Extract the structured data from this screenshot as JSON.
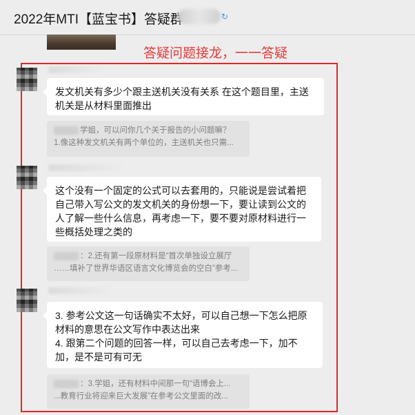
{
  "header": {
    "title": "2022年MTI【蓝宝书】答疑群",
    "sticker_glyph": "↻"
  },
  "callout": "答疑问题接龙，一一答疑",
  "messages": [
    {
      "text": "发文机关有多少个跟主送机关没有关系 在这个题目里，主送机关是从材料里面推出",
      "quote_lines": [
        "学姐，可以问你几个关于报告的小问题嘛？",
        "1.像这种发文机关有两个单位的，主送机关也只需..."
      ]
    },
    {
      "text": "这个没有一个固定的公式可以去套用的，只能说是尝试着把自己带入写公文的发文机关的身份想一下，要让读到公文的人了解一些什么信息，再考虑一下，要不要对原材料进行一些概括处理之类的",
      "quote_lines": [
        "：2.还有第一段原材料是“首次单独设立展厅",
        "……填补了世界华语区语言文化博览会的空白”参考..."
      ]
    },
    {
      "text_lines": [
        "3. 参考公文这一句话确实不太好，可以自己想一下怎么把原材料的意思在公文写作中表达出来",
        "4. 跟第二个问题的回答一样，可以自己去考虑一下，加不加，是不是可有可无"
      ],
      "quote_lines": [
        "：3.学姐，还有材料中间那一句“语博会上...",
        "...教育行业将迎来巨大发展”在参考公文里面的改..."
      ]
    }
  ]
}
